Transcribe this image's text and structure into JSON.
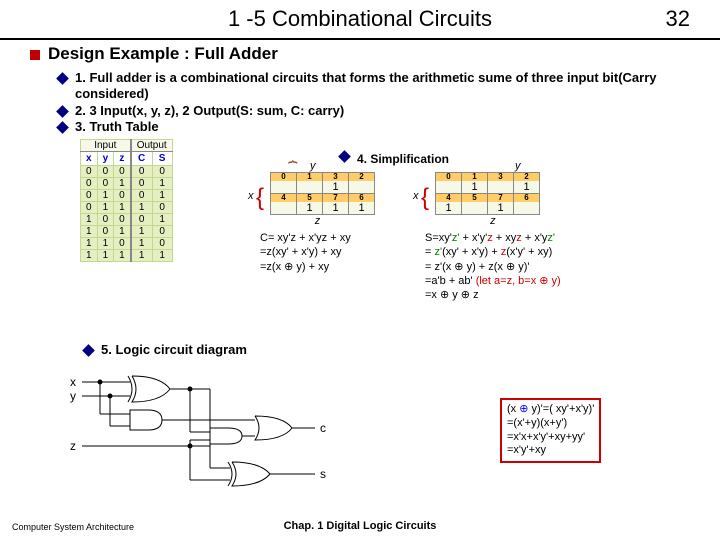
{
  "page_number": "32",
  "title": "1 -5  Combinational Circuits",
  "heading": "Design Example : Full Adder",
  "bullets": {
    "b1": "1. Full adder is a combinational circuits that forms the arithmetic sume of three input bit(Carry considered)",
    "b2": "2. 3 Input(x, y, z), 2 Output(S: sum, C: carry)",
    "b3": "3. Truth Table",
    "b4": "4. Simplification",
    "b5": "5. Logic circuit diagram"
  },
  "truth_table": {
    "group1": "Input",
    "group2": "Output",
    "cols": [
      "x",
      "y",
      "z",
      "C",
      "S"
    ],
    "rows": [
      [
        "0",
        "0",
        "0",
        "0",
        "0"
      ],
      [
        "0",
        "0",
        "1",
        "0",
        "1"
      ],
      [
        "0",
        "1",
        "0",
        "0",
        "1"
      ],
      [
        "0",
        "1",
        "1",
        "1",
        "0"
      ],
      [
        "1",
        "0",
        "0",
        "0",
        "1"
      ],
      [
        "1",
        "0",
        "1",
        "1",
        "0"
      ],
      [
        "1",
        "1",
        "0",
        "1",
        "0"
      ],
      [
        "1",
        "1",
        "1",
        "1",
        "1"
      ]
    ]
  },
  "axes": {
    "x": "x",
    "y": "y",
    "z": "z"
  },
  "kmap_c": {
    "idx": [
      "0",
      "1",
      "3",
      "2",
      "4",
      "5",
      "7",
      "6"
    ],
    "val": [
      "",
      "",
      "1",
      "",
      "",
      "1",
      "1",
      "1"
    ]
  },
  "kmap_s": {
    "idx": [
      "0",
      "1",
      "3",
      "2",
      "4",
      "5",
      "7",
      "6"
    ],
    "val": [
      "",
      "1",
      "",
      "1",
      "1",
      "",
      "1",
      ""
    ]
  },
  "eq_c": {
    "l1": "C= xy'z + x'yz + xy",
    "l2": "  =z(xy' + x'y) + xy",
    "l3": "  =z(x ⊕ y) + xy"
  },
  "eq_s": {
    "l1": "S=xy'z' + x'y'z + xyz + x'yz'",
    "l2": " = z'(xy' + x'y) + z(x'y' + xy)",
    "l3": " = z'(x ⊕ y) + z(x ⊕ y)'",
    "l4a": " =a'b + ab' ",
    "l4b": "(let a=z, b=x ⊕ y)",
    "l5": " =x ⊕ y ⊕ z"
  },
  "note": {
    "l1": "(x ⊕ y)'=( xy'+x'y)'",
    "l2": "=(x'+y)(x+y')",
    "l3": "=x'x+x'y'+xy+yy'",
    "l4": "=x'y'+xy"
  },
  "circuit": {
    "in1": "x",
    "in2": "y",
    "in3": "z",
    "out1": "c",
    "out2": "s"
  },
  "footer_left": "Computer System Architecture",
  "footer_center": "Chap. 1  Digital Logic Circuits"
}
